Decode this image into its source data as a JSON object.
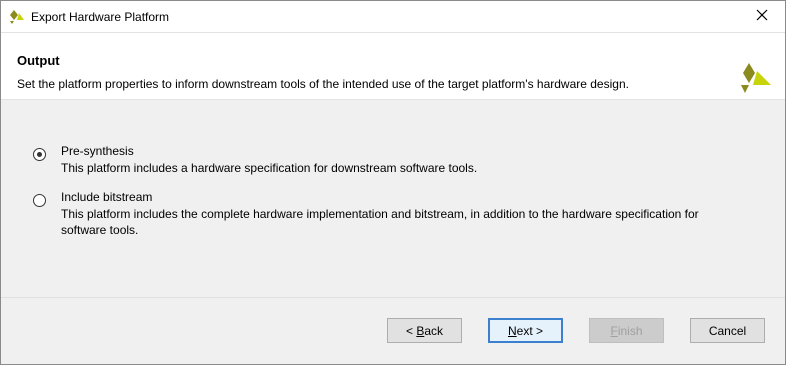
{
  "window": {
    "title": "Export Hardware Platform",
    "icon": "xilinx-logo-icon",
    "close_icon": "close-icon"
  },
  "header": {
    "title": "Output",
    "description": "Set the platform properties to inform downstream tools of the intended use of the target platform's hardware design.",
    "logo": "xilinx-logo-icon"
  },
  "options": [
    {
      "label": "Pre-synthesis",
      "description": "This platform includes a hardware specification for downstream software tools.",
      "selected": true
    },
    {
      "label": "Include bitstream",
      "description": "This platform includes the complete hardware implementation and bitstream, in addition to the hardware specification for software tools.",
      "selected": false
    }
  ],
  "buttons": {
    "back_prefix": "< ",
    "back_mnemonic": "B",
    "back_rest": "ack",
    "next_mnemonic": "N",
    "next_rest": "ext >",
    "finish_mnemonic": "F",
    "finish_rest": "inish",
    "cancel": "Cancel"
  },
  "colors": {
    "accent": "#3c7fcf",
    "logo_olive": "#8a8a1e",
    "logo_yellow": "#c8d40a"
  }
}
